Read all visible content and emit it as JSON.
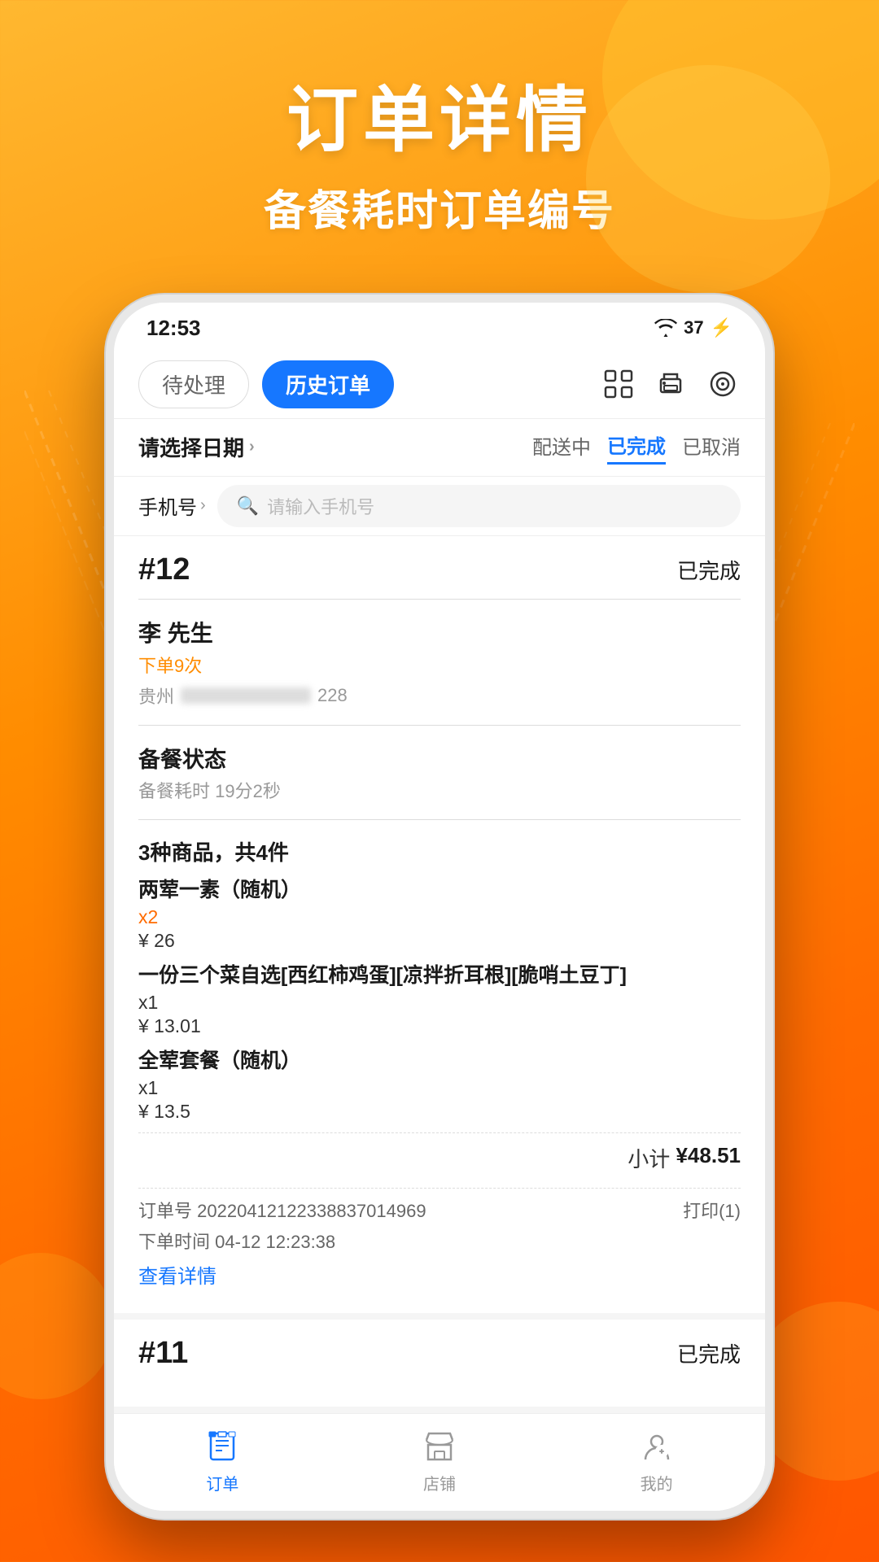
{
  "background": {
    "gradient_start": "#FFB830",
    "gradient_end": "#FF5500"
  },
  "header": {
    "title": "订单详情",
    "subtitle": "备餐耗时订单编号"
  },
  "phone": {
    "status_bar": {
      "time": "12:53",
      "wifi": true,
      "battery": "37"
    },
    "tabs": [
      {
        "label": "待处理",
        "active": false
      },
      {
        "label": "历史订单",
        "active": true
      }
    ],
    "icons": {
      "scan": "⊡",
      "print": "🖨",
      "camera": "◎"
    },
    "filter": {
      "date_label": "请选择日期",
      "statuses": [
        {
          "label": "配送中",
          "active": false
        },
        {
          "label": "已完成",
          "active": true
        },
        {
          "label": "已取消",
          "active": false
        }
      ]
    },
    "search": {
      "phone_label": "手机号",
      "placeholder": "请输入手机号"
    },
    "orders": [
      {
        "number": "#12",
        "status": "已完成",
        "customer_name": "李        先生",
        "order_count": "下单9次",
        "address_prefix": "贵州",
        "address_num": "228",
        "prep_status_label": "备餐状态",
        "prep_time": "备餐耗时 19分2秒",
        "items_summary": "3种商品，共4件",
        "items": [
          {
            "name": "两荤一素（随机）",
            "qty": "x2",
            "qty_color": "orange",
            "price": "¥ 26"
          },
          {
            "name": "一份三个菜自选[西红柿鸡蛋][凉拌折耳根][脆哨土豆丁]",
            "qty": "x1",
            "qty_color": "black",
            "price": "¥ 13.01"
          },
          {
            "name": "全荤套餐（随机）",
            "qty": "x1",
            "qty_color": "black",
            "price": "¥ 13.5"
          }
        ],
        "subtotal_label": "小计",
        "subtotal": "¥48.51",
        "order_id_label": "订单号",
        "order_id": "20220412122338837014969",
        "print_label": "打印(1)",
        "order_time_label": "下单时间",
        "order_time": "04-12 12:23:38",
        "detail_link": "查看详情"
      },
      {
        "number": "#11",
        "status": "已完成"
      }
    ],
    "bottom_nav": [
      {
        "label": "订单",
        "active": true,
        "icon": "order"
      },
      {
        "label": "店铺",
        "active": false,
        "icon": "shop"
      },
      {
        "label": "我的",
        "active": false,
        "icon": "profile"
      }
    ]
  }
}
